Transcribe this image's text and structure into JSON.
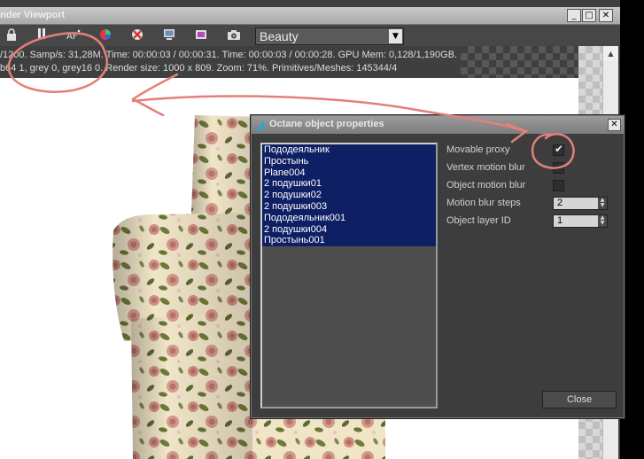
{
  "viewport": {
    "title": "nder Viewport",
    "min": "_",
    "max": "□",
    "close": "✕",
    "pass": "Beauty",
    "status_line_1": "/1200.   Samp/s: 31,28M.   Time: 00:00:03 / 00:00:31.   Time: 00:00:03 / 00:00:28.   GPU Mem: 0,128/1,190GB.",
    "status_line_2": "b64 1, grey 0, grey16 0.   Render size: 1000 x 809.   Zoom: 71%.   Primitives/Meshes: 145344/4"
  },
  "dialog": {
    "title": "Octane object properties",
    "close": "✕",
    "objects": [
      "Пододеяльник",
      "Простынь",
      "Plane004",
      "2 подушки01",
      "2 подушки02",
      "2 подушки003",
      "Пододеяльник001",
      "2 подушки004",
      "Простынь001"
    ],
    "labels": {
      "movable_proxy": "Movable proxy",
      "vertex_motion_blur": "Vertex motion blur",
      "object_motion_blur": "Object motion blur",
      "motion_blur_steps": "Motion blur steps",
      "object_layer_id": "Object layer ID"
    },
    "values": {
      "movable_proxy": true,
      "vertex_motion_blur": false,
      "object_motion_blur": false,
      "motion_blur_steps": "2",
      "object_layer_id": "1"
    },
    "close_button": "Close"
  },
  "colors": {
    "selection": "#0e1f63",
    "annotation": "#e3807a"
  }
}
